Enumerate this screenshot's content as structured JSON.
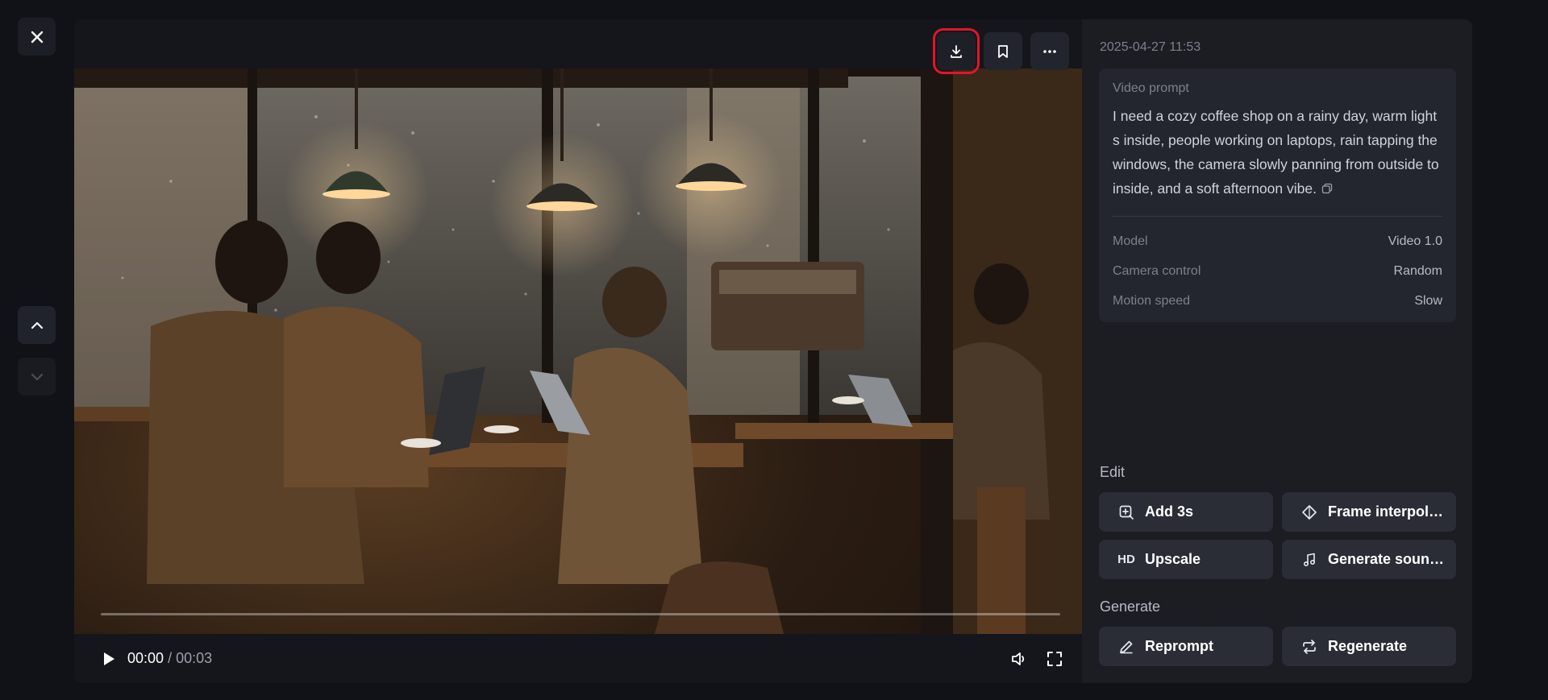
{
  "viewer": {
    "player": {
      "current_time": "00:00",
      "separator": "/",
      "duration": "00:03",
      "progress": 0.0
    }
  },
  "details": {
    "timestamp": "2025-04-27 11:53",
    "prompt_label": "Video prompt",
    "prompt_text": "I need a cozy coffee shop on a rainy day, warm lights inside, people working on laptops, rain tapping the windows, the camera slowly panning from outside to inside, and a soft afternoon vibe.",
    "properties": [
      {
        "key": "Model",
        "value": "Video 1.0"
      },
      {
        "key": "Camera control",
        "value": "Random"
      },
      {
        "key": "Motion speed",
        "value": "Slow"
      }
    ]
  },
  "edit": {
    "title": "Edit",
    "add3s": "Add 3s",
    "frame_interp": "Frame interpolation",
    "upscale": "Upscale",
    "upscale_icon_text": "HD",
    "gen_sound": "Generate sound effects"
  },
  "generate": {
    "title": "Generate",
    "reprompt": "Reprompt",
    "regenerate": "Regenerate"
  },
  "colors": {
    "background": "#111217",
    "panel": "#1b1d23",
    "button": "#2a2d36",
    "highlight": "#e3142a"
  }
}
